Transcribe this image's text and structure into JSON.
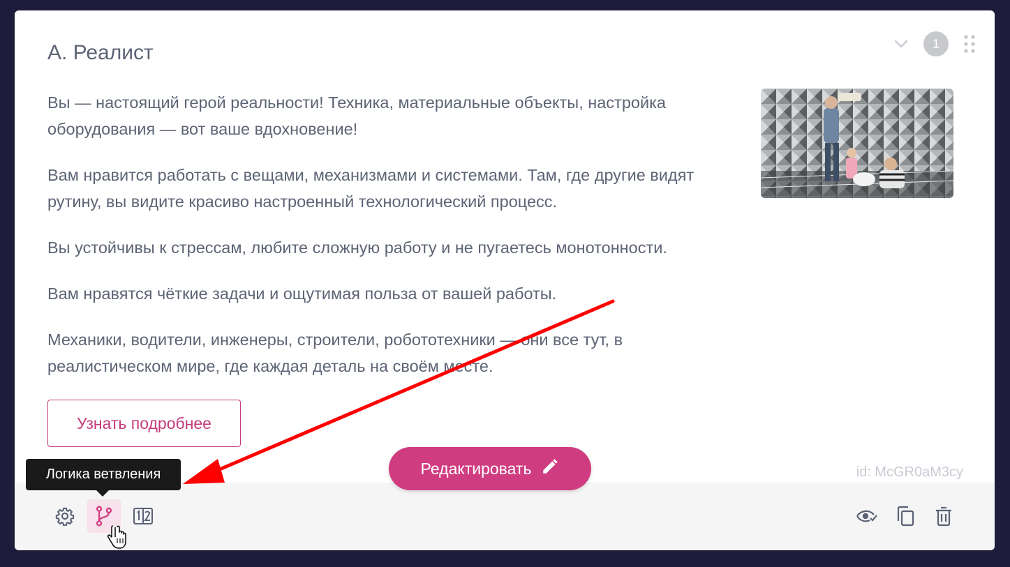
{
  "card": {
    "title": "А. Реалист",
    "paragraphs": [
      "Вы — настоящий герой реальности! Техника, материальные объекты, настройка оборудования — вот ваше вдохновение!",
      "Вам нравится работать с вещами, механизмами и системами. Там, где другие видят рутину, вы видите красиво настроенный технологический процесс.",
      "Вы устойчивы к стрессам, любите сложную работу и не пугаетесь монотонности.",
      "Вам нравятся чёткие задачи и ощутимая польза от вашей работы.",
      "Механики, водители, инженеры, строители, робототехники — они все тут, в реалистическом мире, где каждая деталь на своём месте."
    ],
    "learn_more_label": "Узнать подробнее",
    "id_label": "id: McGR0aM3cy",
    "badge_number": "1"
  },
  "toolbar": {
    "edit_label": "Редактировать",
    "tooltip": "Логика ветвления",
    "left_icons": [
      "gear-icon",
      "branch-icon",
      "score-icon"
    ],
    "right_icons": [
      "eye-check-icon",
      "copy-icon",
      "trash-icon"
    ]
  },
  "colors": {
    "accent": "#d03c80",
    "text": "#5d6475",
    "background": "#1d1d3b",
    "annotation_arrow": "#ff0000"
  }
}
